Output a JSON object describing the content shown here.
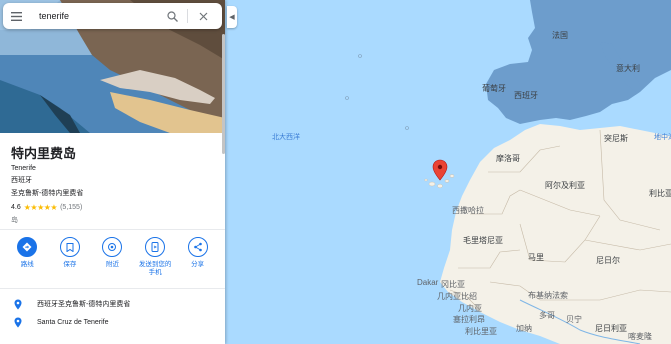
{
  "search": {
    "value": "tenerife",
    "menu_icon": "menu-icon",
    "search_icon": "search-icon",
    "clear_icon": "close-icon"
  },
  "place": {
    "name": "特内里费岛",
    "name_latin": "Tenerife",
    "country": "西班牙",
    "province": "圣克鲁斯-德特内里费省",
    "rating": "4.6",
    "stars": "★★★★★",
    "review_count": "(5,155)",
    "category": "岛"
  },
  "actions": [
    {
      "label": "路线",
      "icon": "directions-icon"
    },
    {
      "label": "保存",
      "icon": "bookmark-icon"
    },
    {
      "label": "附近",
      "icon": "nearby-icon"
    },
    {
      "label": "发送到您的手机",
      "label_line1": "发送到您的",
      "label_line2": "手机",
      "icon": "send-to-phone-icon"
    },
    {
      "label": "分享",
      "icon": "share-icon"
    }
  ],
  "details": [
    {
      "text": "西班牙圣克鲁斯-德特内里费省",
      "icon": "pin-icon"
    },
    {
      "text": "Santa Cruz de Tenerife",
      "icon": "pin-icon"
    }
  ],
  "map": {
    "ocean_label": "北大西洋",
    "labels": [
      "法国",
      "葡萄牙",
      "西班牙",
      "意大利",
      "摩洛哥",
      "阿尔及利亚",
      "突尼斯",
      "利比亚",
      "西撒哈拉",
      "毛里塔尼亚",
      "马里",
      "尼日尔",
      "尼日利亚",
      "布基纳法索",
      "Dakar",
      "冈比亚",
      "几内亚比绍",
      "几内亚",
      "塞拉利昂",
      "利比里亚",
      "加纳",
      "多哥",
      "贝宁",
      "喀麦隆",
      "地中海"
    ],
    "colors": {
      "ocean": "#aadaff",
      "land": "#f4f1e8",
      "europe": "#6a9ac9",
      "marker": "#ea4335"
    }
  }
}
